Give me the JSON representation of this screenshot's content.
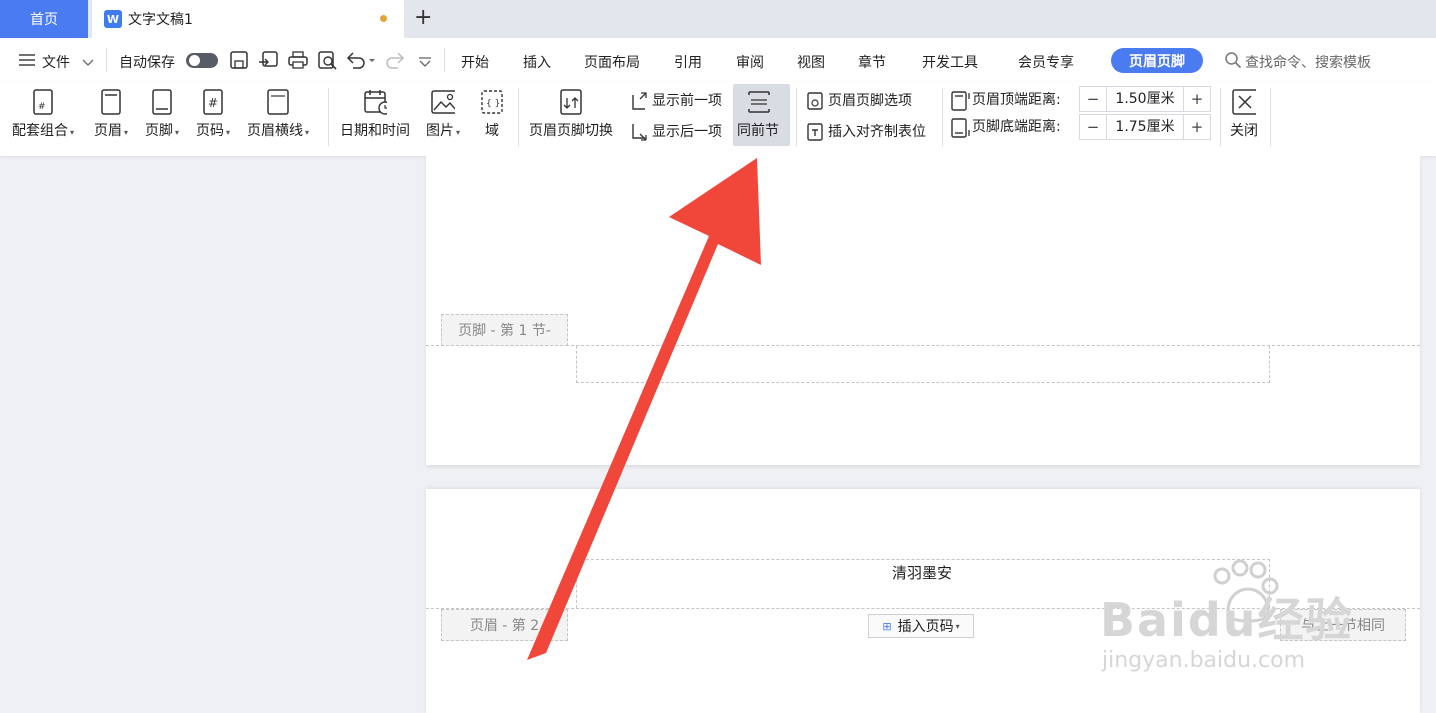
{
  "tabs": {
    "home": "首页",
    "doc_icon": "W",
    "document": "文字文稿1",
    "new_tab": "+"
  },
  "menu": {
    "file": "文件",
    "autosave": "自动保存",
    "start": "开始",
    "insert": "插入",
    "page_layout": "页面布局",
    "references": "引用",
    "review": "审阅",
    "view": "视图",
    "chapter": "章节",
    "dev_tools": "开发工具",
    "member": "会员专享",
    "header_footer": "页眉页脚",
    "search": "查找命令、搜索模板"
  },
  "ribbon": {
    "combo": "配套组合",
    "header": "页眉",
    "footer": "页脚",
    "page_number": "页码",
    "header_line": "页眉横线",
    "date_time": "日期和时间",
    "picture": "图片",
    "field": "域",
    "switch": "页眉页脚切换",
    "show_prev": "显示前一项",
    "show_next": "显示后一项",
    "same_as_prev": "同前节",
    "options": "页眉页脚选项",
    "insert_align_tab": "插入对齐制表位",
    "header_top_label": "页眉顶端距离:",
    "header_top_value": "1.50厘米",
    "footer_bottom_label": "页脚底端距离:",
    "footer_bottom_value": "1.75厘米",
    "close": "关闭",
    "minus": "−",
    "plus": "+"
  },
  "document": {
    "footer_label": "页脚  - 第 1 节-",
    "header_text": "清羽墨安",
    "header_label": "页眉  - 第 2",
    "insert_page_number": "插入页码",
    "same_as_prev_tag": "与上一节相同"
  },
  "watermark": {
    "brand": "Baidu经验",
    "url": "jingyan.baidu.com"
  },
  "colors": {
    "accent": "#4b7bf0",
    "arrow": "#f0473a",
    "unsaved": "#e0a33a"
  }
}
